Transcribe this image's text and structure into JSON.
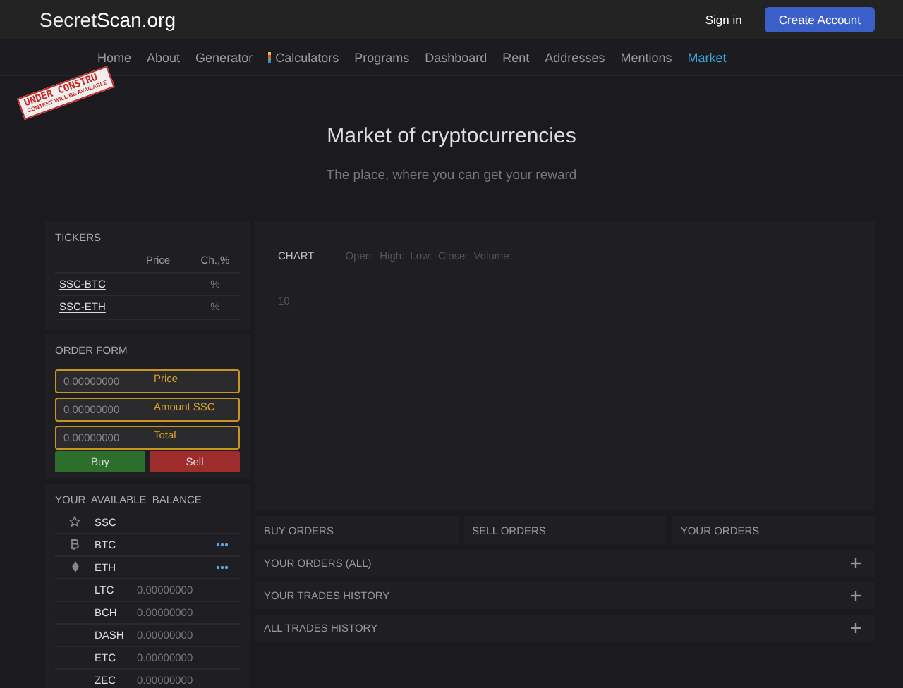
{
  "header": {
    "logo": {
      "light": "Secret",
      "bold": "Scan.org"
    },
    "sign_in": "Sign in",
    "create_account": "Create Account"
  },
  "nav": [
    {
      "label": "Home",
      "selected": false,
      "icon": false
    },
    {
      "label": "About",
      "selected": false,
      "icon": false
    },
    {
      "label": "Generator",
      "selected": false,
      "icon": false
    },
    {
      "label": "Calculators",
      "selected": false,
      "icon": true
    },
    {
      "label": "Programs",
      "selected": false,
      "icon": false
    },
    {
      "label": "Dashboard",
      "selected": false,
      "icon": false
    },
    {
      "label": "Rent",
      "selected": false,
      "icon": false
    },
    {
      "label": "Addresses",
      "selected": false,
      "icon": false
    },
    {
      "label": "Mentions",
      "selected": false,
      "icon": false
    },
    {
      "label": "Market",
      "selected": true,
      "icon": false
    }
  ],
  "stamp": {
    "title": "UNDER CONSTRU",
    "subtitle": "CONTENT WILL BE AVAILABLE"
  },
  "hero": {
    "title": "Market of cryptocurrencies",
    "subtitle": "The place, where you can get your reward"
  },
  "tickers": {
    "title": "TICKERS",
    "columns": [
      "Price",
      "Ch.,%"
    ],
    "rows": [
      {
        "pair": "SSC-BTC",
        "change": "%"
      },
      {
        "pair": "SSC-ETH",
        "change": "%"
      }
    ]
  },
  "order_form": {
    "title": "ORDER FORM",
    "fields": [
      {
        "placeholder": "0.00000000",
        "label": "Price"
      },
      {
        "placeholder": "0.00000000",
        "label": "Amount SSC"
      },
      {
        "placeholder": "0.00000000",
        "label": "Total"
      }
    ],
    "buy": "Buy",
    "sell": "Sell"
  },
  "balance": {
    "title": "YOUR  AVAILABLE  BALANCE",
    "rows": [
      {
        "coin": "SSC",
        "menu": false
      },
      {
        "coin": "BTC",
        "menu": true
      },
      {
        "coin": "ETH",
        "menu": true
      },
      {
        "coin": "LTC",
        "amount": "0.00000000",
        "menu": false
      },
      {
        "coin": "BCH",
        "amount": "0.00000000",
        "menu": false
      },
      {
        "coin": "DASH",
        "amount": "0.00000000",
        "menu": false
      },
      {
        "coin": "ETC",
        "amount": "0.00000000",
        "menu": false
      },
      {
        "coin": "ZEC",
        "amount": "0.00000000",
        "menu": false
      }
    ]
  },
  "chart": {
    "title": "CHART",
    "stats": [
      "Open:",
      "High:",
      "Low:",
      "Close:",
      "Volume:"
    ],
    "axis_label": "10"
  },
  "order_tabs": [
    "BUY ORDERS",
    "SELL ORDERS",
    "YOUR ORDERS"
  ],
  "sections": [
    {
      "title": "YOUR ORDERS (ALL)",
      "expanded": false
    },
    {
      "title": "YOUR TRADES HISTORY",
      "expanded": false
    },
    {
      "title": "ALL TRADES HISTORY",
      "expanded": false
    }
  ]
}
